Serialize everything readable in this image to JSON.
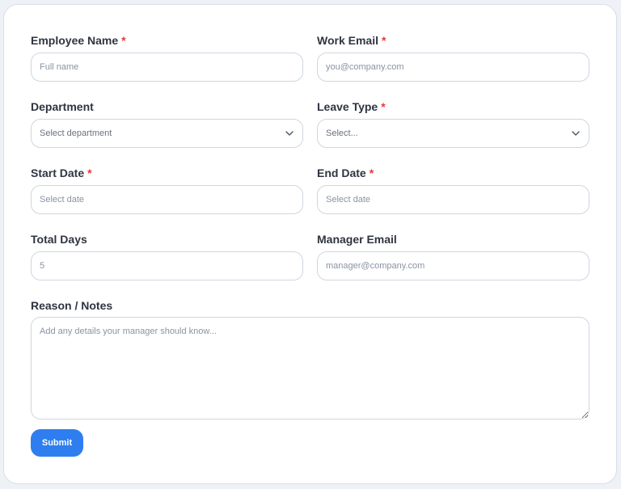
{
  "form": {
    "employee_name": {
      "label": "Employee Name",
      "required_mark": "*",
      "placeholder": "Full name"
    },
    "work_email": {
      "label": "Work Email",
      "required_mark": "*",
      "placeholder": "you@company.com"
    },
    "department": {
      "label": "Department",
      "selected": "Select department",
      "icon": "chevron-down-icon"
    },
    "leave_type": {
      "label": "Leave Type",
      "required_mark": "*",
      "selected": "Select...",
      "icon": "chevron-down-icon"
    },
    "start_date": {
      "label": "Start Date",
      "required_mark": "*",
      "placeholder": "Select date"
    },
    "end_date": {
      "label": "End Date",
      "required_mark": "*",
      "placeholder": "Select date"
    },
    "total_days": {
      "label": "Total Days",
      "placeholder": "5"
    },
    "manager_email": {
      "label": "Manager Email",
      "placeholder": "manager@company.com"
    },
    "reason_notes": {
      "label": "Reason / Notes",
      "placeholder": "Add any details your manager should know..."
    },
    "submit_label": "Submit"
  },
  "colors": {
    "accent": "#2f7ef0",
    "required": "#e53935",
    "label_text": "#2f3441",
    "border": "#cfd6e0",
    "placeholder": "#8a93a3"
  }
}
